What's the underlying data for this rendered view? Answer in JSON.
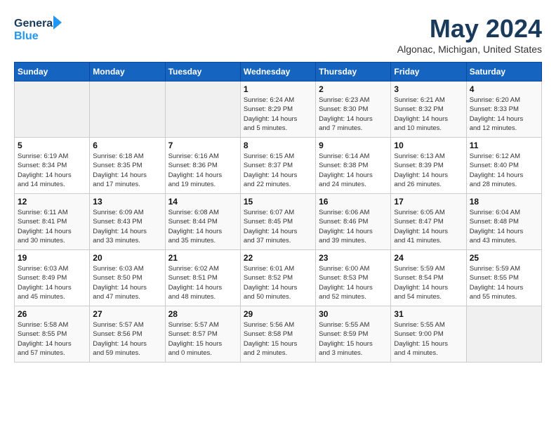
{
  "logo": {
    "line1": "General",
    "line2": "Blue"
  },
  "title": "May 2024",
  "location": "Algonac, Michigan, United States",
  "days_of_week": [
    "Sunday",
    "Monday",
    "Tuesday",
    "Wednesday",
    "Thursday",
    "Friday",
    "Saturday"
  ],
  "weeks": [
    [
      {
        "day": "",
        "info": ""
      },
      {
        "day": "",
        "info": ""
      },
      {
        "day": "",
        "info": ""
      },
      {
        "day": "1",
        "info": "Sunrise: 6:24 AM\nSunset: 8:29 PM\nDaylight: 14 hours\nand 5 minutes."
      },
      {
        "day": "2",
        "info": "Sunrise: 6:23 AM\nSunset: 8:30 PM\nDaylight: 14 hours\nand 7 minutes."
      },
      {
        "day": "3",
        "info": "Sunrise: 6:21 AM\nSunset: 8:32 PM\nDaylight: 14 hours\nand 10 minutes."
      },
      {
        "day": "4",
        "info": "Sunrise: 6:20 AM\nSunset: 8:33 PM\nDaylight: 14 hours\nand 12 minutes."
      }
    ],
    [
      {
        "day": "5",
        "info": "Sunrise: 6:19 AM\nSunset: 8:34 PM\nDaylight: 14 hours\nand 14 minutes."
      },
      {
        "day": "6",
        "info": "Sunrise: 6:18 AM\nSunset: 8:35 PM\nDaylight: 14 hours\nand 17 minutes."
      },
      {
        "day": "7",
        "info": "Sunrise: 6:16 AM\nSunset: 8:36 PM\nDaylight: 14 hours\nand 19 minutes."
      },
      {
        "day": "8",
        "info": "Sunrise: 6:15 AM\nSunset: 8:37 PM\nDaylight: 14 hours\nand 22 minutes."
      },
      {
        "day": "9",
        "info": "Sunrise: 6:14 AM\nSunset: 8:38 PM\nDaylight: 14 hours\nand 24 minutes."
      },
      {
        "day": "10",
        "info": "Sunrise: 6:13 AM\nSunset: 8:39 PM\nDaylight: 14 hours\nand 26 minutes."
      },
      {
        "day": "11",
        "info": "Sunrise: 6:12 AM\nSunset: 8:40 PM\nDaylight: 14 hours\nand 28 minutes."
      }
    ],
    [
      {
        "day": "12",
        "info": "Sunrise: 6:11 AM\nSunset: 8:41 PM\nDaylight: 14 hours\nand 30 minutes."
      },
      {
        "day": "13",
        "info": "Sunrise: 6:09 AM\nSunset: 8:43 PM\nDaylight: 14 hours\nand 33 minutes."
      },
      {
        "day": "14",
        "info": "Sunrise: 6:08 AM\nSunset: 8:44 PM\nDaylight: 14 hours\nand 35 minutes."
      },
      {
        "day": "15",
        "info": "Sunrise: 6:07 AM\nSunset: 8:45 PM\nDaylight: 14 hours\nand 37 minutes."
      },
      {
        "day": "16",
        "info": "Sunrise: 6:06 AM\nSunset: 8:46 PM\nDaylight: 14 hours\nand 39 minutes."
      },
      {
        "day": "17",
        "info": "Sunrise: 6:05 AM\nSunset: 8:47 PM\nDaylight: 14 hours\nand 41 minutes."
      },
      {
        "day": "18",
        "info": "Sunrise: 6:04 AM\nSunset: 8:48 PM\nDaylight: 14 hours\nand 43 minutes."
      }
    ],
    [
      {
        "day": "19",
        "info": "Sunrise: 6:03 AM\nSunset: 8:49 PM\nDaylight: 14 hours\nand 45 minutes."
      },
      {
        "day": "20",
        "info": "Sunrise: 6:03 AM\nSunset: 8:50 PM\nDaylight: 14 hours\nand 47 minutes."
      },
      {
        "day": "21",
        "info": "Sunrise: 6:02 AM\nSunset: 8:51 PM\nDaylight: 14 hours\nand 48 minutes."
      },
      {
        "day": "22",
        "info": "Sunrise: 6:01 AM\nSunset: 8:52 PM\nDaylight: 14 hours\nand 50 minutes."
      },
      {
        "day": "23",
        "info": "Sunrise: 6:00 AM\nSunset: 8:53 PM\nDaylight: 14 hours\nand 52 minutes."
      },
      {
        "day": "24",
        "info": "Sunrise: 5:59 AM\nSunset: 8:54 PM\nDaylight: 14 hours\nand 54 minutes."
      },
      {
        "day": "25",
        "info": "Sunrise: 5:59 AM\nSunset: 8:55 PM\nDaylight: 14 hours\nand 55 minutes."
      }
    ],
    [
      {
        "day": "26",
        "info": "Sunrise: 5:58 AM\nSunset: 8:55 PM\nDaylight: 14 hours\nand 57 minutes."
      },
      {
        "day": "27",
        "info": "Sunrise: 5:57 AM\nSunset: 8:56 PM\nDaylight: 14 hours\nand 59 minutes."
      },
      {
        "day": "28",
        "info": "Sunrise: 5:57 AM\nSunset: 8:57 PM\nDaylight: 15 hours\nand 0 minutes."
      },
      {
        "day": "29",
        "info": "Sunrise: 5:56 AM\nSunset: 8:58 PM\nDaylight: 15 hours\nand 2 minutes."
      },
      {
        "day": "30",
        "info": "Sunrise: 5:55 AM\nSunset: 8:59 PM\nDaylight: 15 hours\nand 3 minutes."
      },
      {
        "day": "31",
        "info": "Sunrise: 5:55 AM\nSunset: 9:00 PM\nDaylight: 15 hours\nand 4 minutes."
      },
      {
        "day": "",
        "info": ""
      }
    ]
  ]
}
